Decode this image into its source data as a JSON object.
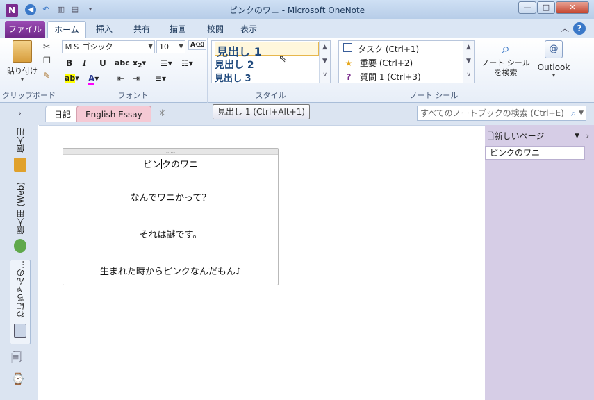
{
  "window": {
    "title": "ピンクのワニ - Microsoft OneNote",
    "app_icon_letter": "N"
  },
  "ribbon_tabs": [
    {
      "label": "ファイル"
    },
    {
      "label": "ホーム"
    },
    {
      "label": "挿入"
    },
    {
      "label": "共有"
    },
    {
      "label": "描画"
    },
    {
      "label": "校閲"
    },
    {
      "label": "表示"
    }
  ],
  "clipboard": {
    "paste_label": "貼り付け",
    "group_label": "クリップボード"
  },
  "font": {
    "name_value": "ＭＳ ゴシック",
    "size_value": "10",
    "group_label": "フォント"
  },
  "styles": {
    "items": [
      "見出し 1",
      "見出し 2",
      "見出し 3"
    ],
    "group_label": "スタイル"
  },
  "tags": {
    "items": [
      {
        "label": "タスク (Ctrl+1)",
        "icon": "checkbox-icon"
      },
      {
        "label": "重要 (Ctrl+2)",
        "icon": "star-icon"
      },
      {
        "label": "質問 1 (Ctrl+3)",
        "icon": "question-icon"
      }
    ],
    "find_tags_label": "ノート シールを検索",
    "group_label": "ノート シール"
  },
  "outlook": {
    "label": "Outlook"
  },
  "tooltip": "見出し 1 (Ctrl+Alt+1)",
  "sections": [
    {
      "label": "日記",
      "color": "#ffffff"
    },
    {
      "label": "English Essay",
      "color": "#f5c9d4"
    }
  ],
  "search": {
    "placeholder": "すべてのノートブックの検索 (Ctrl+E)"
  },
  "notebooks": [
    {
      "label": "個人用"
    },
    {
      "label": "個人用 (Web)"
    },
    {
      "label": "わにちゃんの…"
    }
  ],
  "note": {
    "title_before_caret": "ピン",
    "title_after_caret": "クのワニ",
    "lines": [
      "なんでワニかって？",
      "それは謎です。",
      "生まれた時からピンクなんだもん♪"
    ]
  },
  "pages": {
    "new_page_label": "新しいページ",
    "items": [
      "ピンクのワニ"
    ]
  }
}
